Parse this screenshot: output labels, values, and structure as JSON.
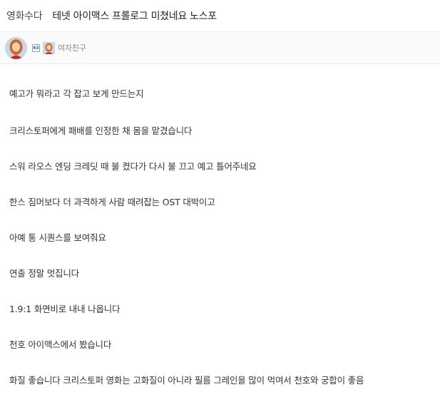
{
  "header": {
    "board_name": "영화수다",
    "post_title": "테넷 아이맥스 프롤로그 미쳤네요 노스포"
  },
  "author": {
    "level": "63",
    "nickname": "여자친구"
  },
  "body": {
    "lines": [
      "예고가 뭐라고 각 잡고 보게 만드는지",
      "크리스토퍼에게 패배를 인정한 채 몸을 맡겼습니다",
      "스워 라오스 엔딩 크레딧 때 불 켰다가 다시 불 끄고 예고 틀어주네요",
      "한스 짐머보다 더 과격하게 사람 때려잡는 OST 대박이고",
      "아예 통 시퀀스를 보여줘요",
      "연출 정말 멋집니다",
      "1.9:1 화면비로 내내 나옵니다",
      "천호 아이맥스에서 봤습니다",
      "화질 좋습니다 크리스토퍼 영화는 고화질이 아니라 필름 그레인을 많이 먹여서 천호와 궁합이 좋음"
    ]
  }
}
